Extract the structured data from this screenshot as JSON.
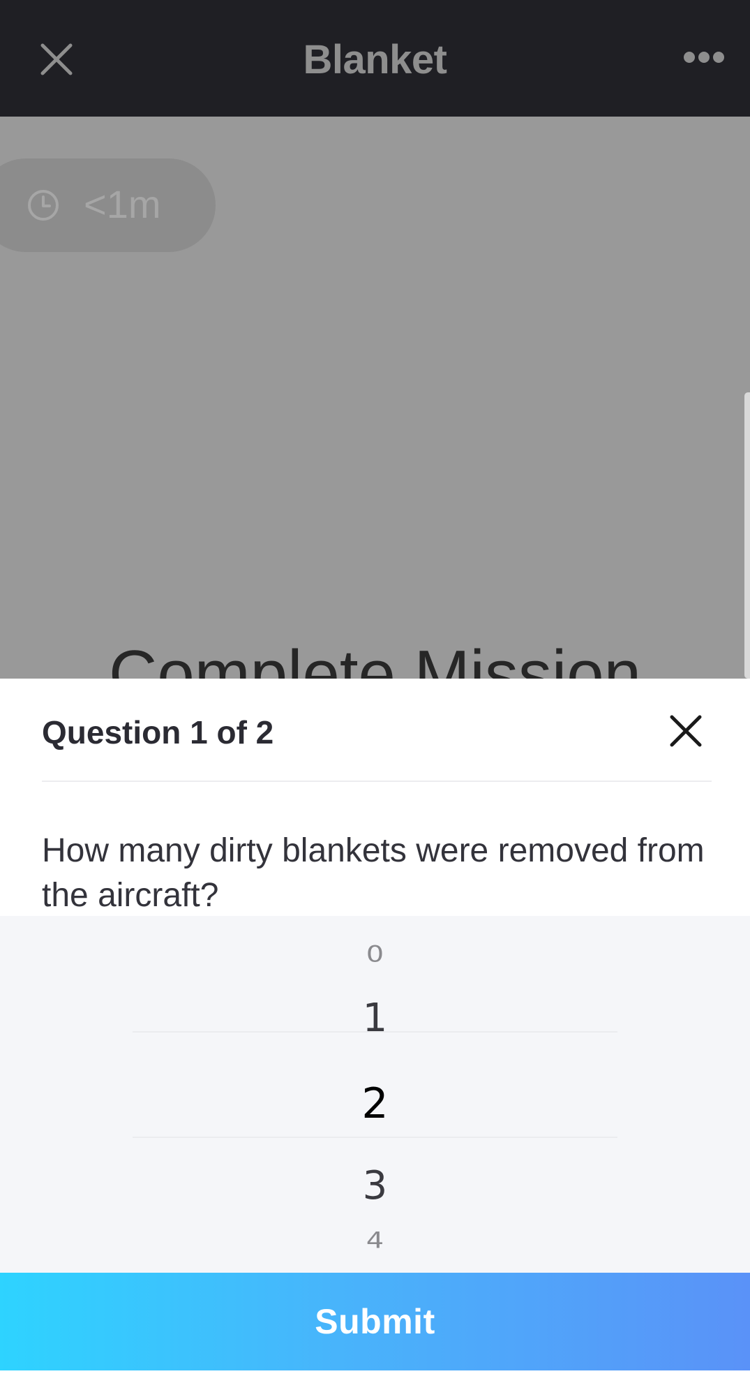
{
  "header": {
    "title": "Blanket",
    "close_icon": "close-icon",
    "more_icon": "more-horizontal-icon"
  },
  "background": {
    "duration_icon": "clock-icon",
    "duration": "<1m",
    "title": "Complete Mission"
  },
  "question_sheet": {
    "counter": "Question 1 of 2",
    "close_icon": "close-icon",
    "question": "How many dirty blankets were removed from the aircraft?",
    "picker": {
      "options": [
        "0",
        "1",
        "2",
        "3",
        "4"
      ],
      "selected": "2"
    },
    "submit_label": "Submit"
  },
  "colors": {
    "header_bg": "#1f1f24",
    "overlay": "#999999",
    "submit_gradient_start": "#2ed3ff",
    "submit_gradient_end": "#5a92f8"
  }
}
